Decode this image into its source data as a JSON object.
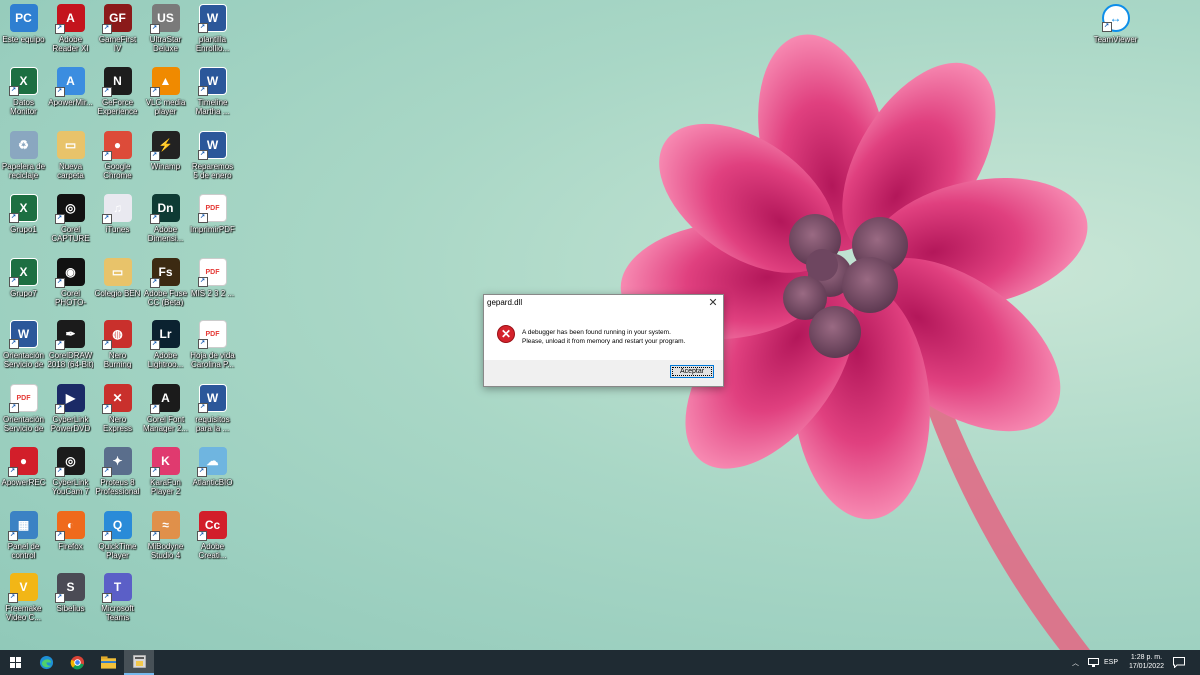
{
  "desktop": {
    "icons": [
      {
        "label": "Este equipo",
        "glyph": "PC",
        "color": "#2f7fd1"
      },
      {
        "label": "Adobe Reader XI",
        "glyph": "A",
        "color": "#c4141d"
      },
      {
        "label": "GameFirst IV",
        "glyph": "GF",
        "color": "#8b1a1a"
      },
      {
        "label": "UltraStar Deluxe",
        "glyph": "US",
        "color": "#7a7a7a"
      },
      {
        "label": "plantilla Enrollio...",
        "glyph": "W",
        "color": "#2b579a"
      },
      {
        "label": "Datos Monitor",
        "glyph": "X",
        "color": "#1d6f42"
      },
      {
        "label": "ApowerMir...",
        "glyph": "A",
        "color": "#3b8de0"
      },
      {
        "label": "GeForce Experience",
        "glyph": "N",
        "color": "#1d1d1d"
      },
      {
        "label": "VLC media player",
        "glyph": "▲",
        "color": "#f08a00"
      },
      {
        "label": "Timeline Martha ...",
        "glyph": "W",
        "color": "#2b579a"
      },
      {
        "label": "Papelera de reciclaje",
        "glyph": "♻",
        "color": "#8aa7c0"
      },
      {
        "label": "Nueva carpeta",
        "glyph": "▭",
        "color": "#e8c36a"
      },
      {
        "label": "Google Chrome",
        "glyph": "●",
        "color": "#dd4b39"
      },
      {
        "label": "Winamp",
        "glyph": "⚡",
        "color": "#222222"
      },
      {
        "label": "Reparemos 5 de enero d...",
        "glyph": "W",
        "color": "#2b579a"
      },
      {
        "label": "Grupo1",
        "glyph": "X",
        "color": "#1d6f42"
      },
      {
        "label": "Corel CAPTURE ...",
        "glyph": "◎",
        "color": "#111111"
      },
      {
        "label": "iTunes",
        "glyph": "♫",
        "color": "#e9e9f0"
      },
      {
        "label": "Adobe Dimensi...",
        "glyph": "Dn",
        "color": "#0e3b34"
      },
      {
        "label": "ImprimirPDF",
        "glyph": "PDF",
        "color": "#e53935"
      },
      {
        "label": "Grupo7",
        "glyph": "X",
        "color": "#1d6f42"
      },
      {
        "label": "Corel PHOTO-PAI...",
        "glyph": "◉",
        "color": "#111111"
      },
      {
        "label": "Colegio BEN",
        "glyph": "▭",
        "color": "#e8c36a"
      },
      {
        "label": "Adobe Fuse CC (Beta)",
        "glyph": "Fs",
        "color": "#3c2a12"
      },
      {
        "label": "MIS 2 3 2 ...",
        "glyph": "PDF",
        "color": "#e53935"
      },
      {
        "label": "Orientación Servicio de ...",
        "glyph": "W",
        "color": "#2b579a"
      },
      {
        "label": "CorelDRAW 2018 (64-Bit)",
        "glyph": "✒",
        "color": "#1b1b1b"
      },
      {
        "label": "Nero Burning ROM",
        "glyph": "◍",
        "color": "#c9302c"
      },
      {
        "label": "Adobe Lightroo...",
        "glyph": "Lr",
        "color": "#0b2230"
      },
      {
        "label": "Hoja de vida Carolina P...",
        "glyph": "PDF",
        "color": "#e53935"
      },
      {
        "label": "Orientación Servicio de ...",
        "glyph": "PDF",
        "color": "#e53935"
      },
      {
        "label": "CyberLink PowerDVD 17",
        "glyph": "▶",
        "color": "#1b2a66"
      },
      {
        "label": "Nero Express",
        "glyph": "✕",
        "color": "#c9302c"
      },
      {
        "label": "Corel Font Manager 2...",
        "glyph": "A",
        "color": "#1b1b1b"
      },
      {
        "label": "requisitos para la ...",
        "glyph": "W",
        "color": "#2b579a"
      },
      {
        "label": "ApowerREC",
        "glyph": "●",
        "color": "#d21e2a"
      },
      {
        "label": "CyberLink YouCam 7",
        "glyph": "◎",
        "color": "#1b1b1b"
      },
      {
        "label": "Proteus 8 Professional",
        "glyph": "✦",
        "color": "#5a6e8c"
      },
      {
        "label": "KaraFun Player 2",
        "glyph": "K",
        "color": "#e03a6f"
      },
      {
        "label": "AtlanticBIO",
        "glyph": "☁",
        "color": "#6fb5e0"
      },
      {
        "label": "Panel de control",
        "glyph": "▦",
        "color": "#3b82c4"
      },
      {
        "label": "Firefox",
        "glyph": "◐",
        "color": "#ef6a1c"
      },
      {
        "label": "QuickTime Player",
        "glyph": "Q",
        "color": "#2a8bd8"
      },
      {
        "label": "MiBodyne Studio 4",
        "glyph": "≈",
        "color": "#e0904a"
      },
      {
        "label": "Adobe Creati...",
        "glyph": "Cc",
        "color": "#d21e2a"
      },
      {
        "label": "Freemake Video C...",
        "glyph": "V",
        "color": "#f2b616"
      },
      {
        "label": "Sibelius",
        "glyph": "S",
        "color": "#4b4b55"
      },
      {
        "label": "Microsoft Teams",
        "glyph": "T",
        "color": "#5b5fc7"
      }
    ],
    "right_icon": {
      "label": "TeamViewer",
      "glyph": "↔",
      "color": "#0e8ee9"
    }
  },
  "dialog": {
    "title": "gepard.dll",
    "close": "✕",
    "message_line1": "A debugger has been found running in your system.",
    "message_line2": "Please, unload it from memory and restart your program.",
    "ok_label": "Aceptar",
    "icon": "error-icon"
  },
  "taskbar": {
    "language": "ESP",
    "time": "1:28 p. m.",
    "date": "17/01/2022",
    "start_icon": "windows-logo-icon",
    "pinned": [
      "edge-icon",
      "chrome-icon",
      "file-explorer-icon",
      "gepard-app-icon"
    ]
  },
  "colors": {
    "accent": "#0078d7",
    "taskbar": "#1f2b33",
    "error": "#d4232c"
  }
}
